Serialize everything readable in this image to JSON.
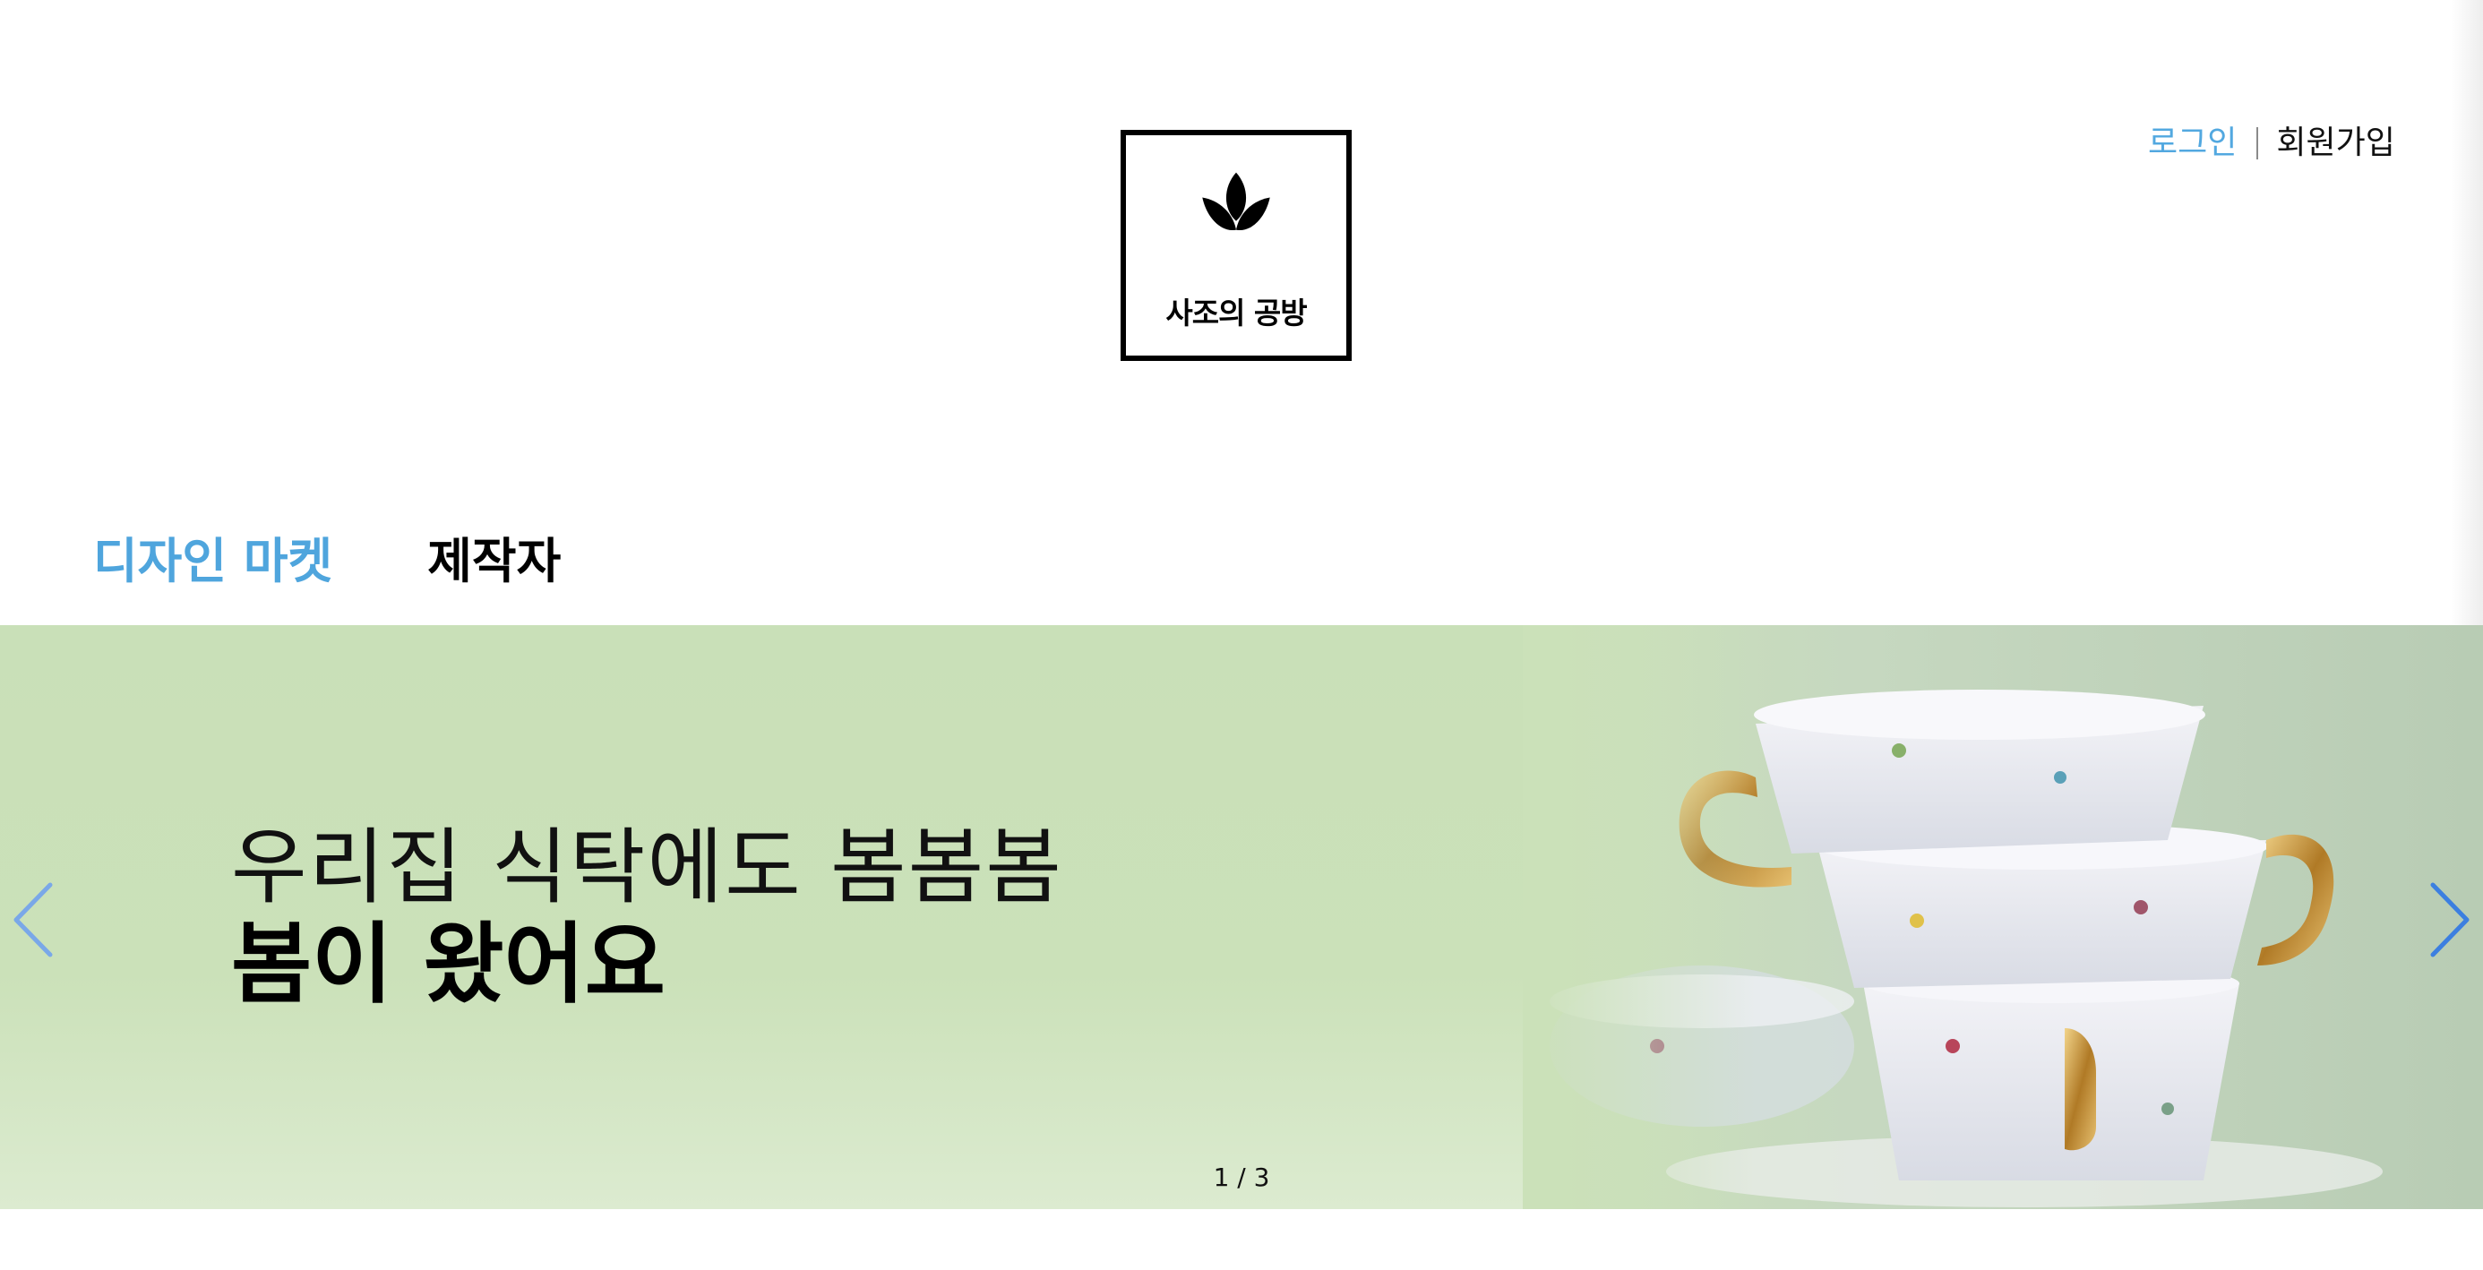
{
  "header": {
    "login_label": "로그인",
    "signup_label": "회원가입"
  },
  "logo": {
    "text": "사조의 공방",
    "icon": "leaf-icon"
  },
  "nav": {
    "tabs": [
      {
        "label": "디자인 마켓",
        "active": true
      },
      {
        "label": "제작자",
        "active": false
      }
    ]
  },
  "banner": {
    "line1": "우리집 식탁에도 봄봄봄",
    "line2": "봄이 왔어요",
    "pager": "1 / 3",
    "prev_icon": "chevron-left-icon",
    "next_icon": "chevron-right-icon",
    "image": "stacked-teacups-photo"
  },
  "colors": {
    "accent": "#4fa5dd",
    "banner_bg": "#cbe1b9",
    "arrow": "#3c7fe0"
  }
}
